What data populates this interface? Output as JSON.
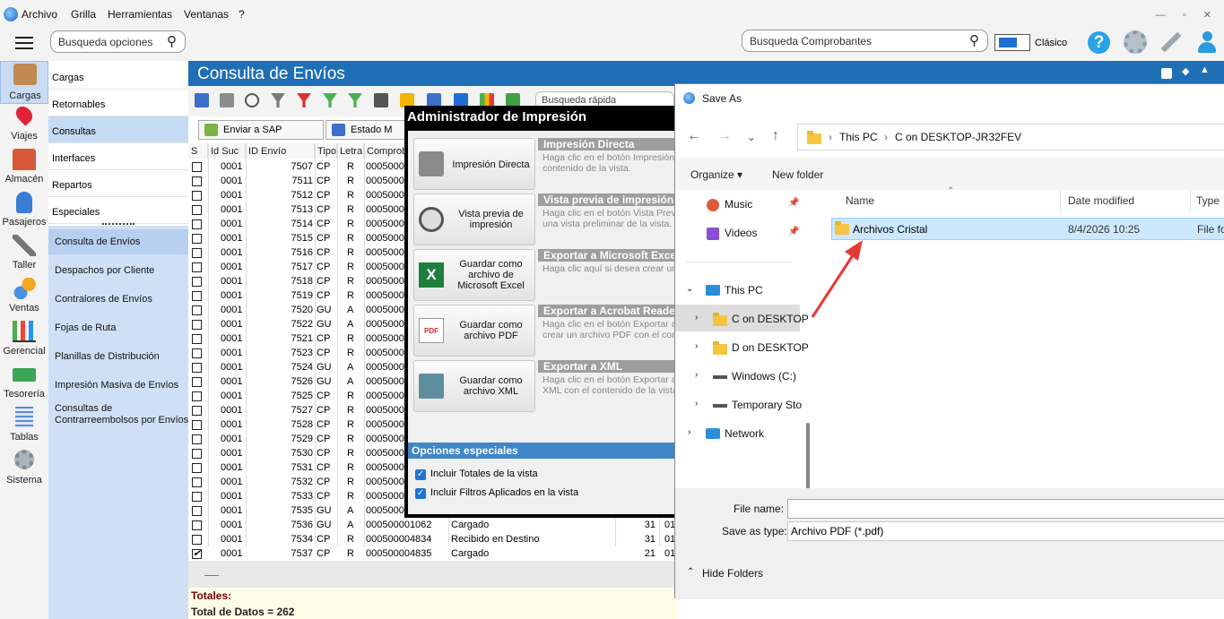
{
  "menu": {
    "items": [
      "Archivo",
      "Grilla",
      "Herramientas",
      "Ventanas",
      "?"
    ]
  },
  "topbar": {
    "search_options_placeholder": "Busqueda opciones",
    "search_vouchers_placeholder": "Busqueda Comprobantes",
    "theme_label": "Clásico"
  },
  "iconnav": [
    {
      "label": "Cargas",
      "selected": true
    },
    {
      "label": "Viajes"
    },
    {
      "label": "Almacén"
    },
    {
      "label": "Pasajeros"
    },
    {
      "label": "Taller"
    },
    {
      "label": "Ventas"
    },
    {
      "label": "Gerencial"
    },
    {
      "label": "Tesorería"
    },
    {
      "label": "Tablas"
    },
    {
      "label": "Sistema"
    }
  ],
  "submenu": {
    "top": [
      "Cargas",
      "Retornables",
      "Consultas",
      "Interfaces",
      "Repartos",
      "Especiales"
    ],
    "selected_top": "Consultas",
    "items": [
      "Consulta de Envíos",
      "Despachos por Cliente",
      "Contralores de Envíos",
      "Fojas de Ruta",
      "Planillas de Distribución",
      "Impresión Masiva de Envíos",
      "Consultas de",
      "Contrarreembolsos por Envíos"
    ]
  },
  "main": {
    "title": "Consulta de Envíos",
    "quick_search_placeholder": "Busqueda rápida",
    "btn_sap": "Enviar a SAP",
    "btn_estado": "Estado M"
  },
  "grid": {
    "headers": [
      "S",
      "Id Suc",
      "ID Envío",
      "Tipo",
      "Letra",
      "Comprob"
    ],
    "rows": [
      {
        "suc": "0001",
        "id": "7507",
        "tipo": "CP",
        "letra": "R",
        "comp": "00050000",
        "checked": false
      },
      {
        "suc": "0001",
        "id": "7511",
        "tipo": "CP",
        "letra": "R",
        "comp": "00050000",
        "checked": false
      },
      {
        "suc": "0001",
        "id": "7512",
        "tipo": "CP",
        "letra": "R",
        "comp": "00050000",
        "checked": false
      },
      {
        "suc": "0001",
        "id": "7513",
        "tipo": "CP",
        "letra": "R",
        "comp": "00050000",
        "checked": false
      },
      {
        "suc": "0001",
        "id": "7514",
        "tipo": "CP",
        "letra": "R",
        "comp": "00050000",
        "checked": false
      },
      {
        "suc": "0001",
        "id": "7515",
        "tipo": "CP",
        "letra": "R",
        "comp": "00050000",
        "checked": false
      },
      {
        "suc": "0001",
        "id": "7516",
        "tipo": "CP",
        "letra": "R",
        "comp": "00050000",
        "checked": false
      },
      {
        "suc": "0001",
        "id": "7517",
        "tipo": "CP",
        "letra": "R",
        "comp": "00050000",
        "checked": false
      },
      {
        "suc": "0001",
        "id": "7518",
        "tipo": "CP",
        "letra": "R",
        "comp": "00050000",
        "checked": false
      },
      {
        "suc": "0001",
        "id": "7519",
        "tipo": "CP",
        "letra": "R",
        "comp": "00050000",
        "checked": false
      },
      {
        "suc": "0001",
        "id": "7520",
        "tipo": "GU",
        "letra": "A",
        "comp": "00050000",
        "checked": false
      },
      {
        "suc": "0001",
        "id": "7522",
        "tipo": "GU",
        "letra": "A",
        "comp": "00050000",
        "checked": false
      },
      {
        "suc": "0001",
        "id": "7521",
        "tipo": "CP",
        "letra": "R",
        "comp": "00050000",
        "checked": false
      },
      {
        "suc": "0001",
        "id": "7523",
        "tipo": "CP",
        "letra": "R",
        "comp": "00050000",
        "checked": false
      },
      {
        "suc": "0001",
        "id": "7524",
        "tipo": "GU",
        "letra": "A",
        "comp": "00050000",
        "checked": false
      },
      {
        "suc": "0001",
        "id": "7526",
        "tipo": "GU",
        "letra": "A",
        "comp": "00050000",
        "checked": false
      },
      {
        "suc": "0001",
        "id": "7525",
        "tipo": "CP",
        "letra": "R",
        "comp": "00050000",
        "checked": false
      },
      {
        "suc": "0001",
        "id": "7527",
        "tipo": "CP",
        "letra": "R",
        "comp": "00050000",
        "checked": false
      },
      {
        "suc": "0001",
        "id": "7528",
        "tipo": "CP",
        "letra": "R",
        "comp": "00050000",
        "checked": false
      },
      {
        "suc": "0001",
        "id": "7529",
        "tipo": "CP",
        "letra": "R",
        "comp": "00050000",
        "checked": false
      },
      {
        "suc": "0001",
        "id": "7530",
        "tipo": "CP",
        "letra": "R",
        "comp": "00050000",
        "checked": false
      },
      {
        "suc": "0001",
        "id": "7531",
        "tipo": "CP",
        "letra": "R",
        "comp": "00050000",
        "checked": false
      },
      {
        "suc": "0001",
        "id": "7532",
        "tipo": "CP",
        "letra": "R",
        "comp": "00050000",
        "checked": false
      },
      {
        "suc": "0001",
        "id": "7533",
        "tipo": "CP",
        "letra": "R",
        "comp": "00050000",
        "checked": false
      },
      {
        "suc": "0001",
        "id": "7535",
        "tipo": "GU",
        "letra": "A",
        "comp": "00050000",
        "checked": false
      },
      {
        "suc": "0001",
        "id": "7536",
        "tipo": "GU",
        "letra": "A",
        "comp": "000500001062",
        "estado": "Cargado",
        "n1": "31",
        "n2": "01",
        "checked": false
      },
      {
        "suc": "0001",
        "id": "7534",
        "tipo": "CP",
        "letra": "R",
        "comp": "000500004834",
        "estado": "Recibido en Destino",
        "n1": "31",
        "n2": "01",
        "checked": false
      },
      {
        "suc": "0001",
        "id": "7537",
        "tipo": "CP",
        "letra": "R",
        "comp": "000500004835",
        "estado": "Cargado",
        "n1": "21",
        "n2": "01",
        "checked": true
      }
    ]
  },
  "totals": {
    "label": "Totales:",
    "count": "Total de Datos = 262"
  },
  "print_dialog": {
    "title": "Administrador de Impresión",
    "buttons": [
      {
        "label": "Impresión Directa",
        "head": "Impresión Directa",
        "desc1": "Haga clic en el botón Impresión",
        "desc2": "contenido de la vista."
      },
      {
        "label": "Vista previa de impresión",
        "head": "Vista previa de impresión",
        "desc1": "Haga clic en el botón Vista Prev",
        "desc2": "una vista preliminar de la vista."
      },
      {
        "label": "Guardar como archivo de Microsoft Excel",
        "head": "Exportar a Microsoft Exce",
        "desc1": "Haga clic aquí si desea crear un",
        "desc2": ""
      },
      {
        "label": "Guardar como archivo PDF",
        "head": "Exportar a Acrobat Reade",
        "desc1": "Haga clic en el botón Exportar a",
        "desc2": "crear un archivo PDF con el con"
      },
      {
        "label": "Guardar como archivo XML",
        "head": "Exportar a XML",
        "desc1": "Haga clic en el botón Exportar a",
        "desc2": "XML con el contenido de la vista"
      }
    ],
    "special_options_title": "Opciones especiales",
    "options": [
      "Incluir Totales de la vista",
      "Incluir Filtros Aplicados en la vista"
    ]
  },
  "save_as": {
    "title": "Save As",
    "breadcrumb": [
      "This PC",
      "C on DESKTOP-JR32FEV"
    ],
    "organize": "Organize",
    "new_folder": "New folder",
    "tree": [
      "Music",
      "Videos",
      "This PC",
      "C on DESKTOP",
      "D on DESKTOP",
      "Windows (C:)",
      "Temporary Sto",
      "Network"
    ],
    "columns": [
      "Name",
      "Date modified",
      "Type"
    ],
    "files": [
      {
        "name": "Archivos Cristal",
        "date": "8/4/2026 10:25",
        "type": "File fo"
      }
    ],
    "file_name_label": "File name:",
    "file_name_value": "",
    "save_type_label": "Save as type:",
    "save_type_value": "Archivo PDF (*.pdf)",
    "hide_folders": "Hide Folders"
  },
  "colors": {
    "header_blue": "#1f6fb6",
    "arrow_red": "#e53935",
    "selection": "#cce8ff"
  }
}
